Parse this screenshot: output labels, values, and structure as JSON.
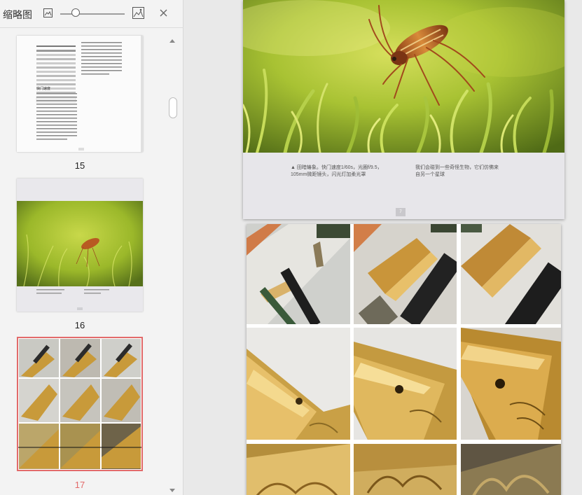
{
  "sidebar": {
    "title": "缩略图",
    "zoom_level": 0.24,
    "thumbnails": [
      {
        "label": "15",
        "selected": false
      },
      {
        "label": "16",
        "selected": false
      },
      {
        "label": "17",
        "selected": true
      }
    ]
  },
  "page16": {
    "caption_left": "▲ 田暗蝽象。快门速度1/60s，光圈f/9.5，\n105mm微距镜头，闪光灯加柔光罩",
    "caption_right": "我们会碰到一些奇怪生物，它们仿佛来\n自另一个星球",
    "page_number": "7"
  },
  "page15_thumb": {
    "heading": "快门速度"
  },
  "colors": {
    "selected_accent": "#e26a6a",
    "sidebar_bg": "#f3f3f3",
    "viewer_bg": "#e9e9e9"
  }
}
